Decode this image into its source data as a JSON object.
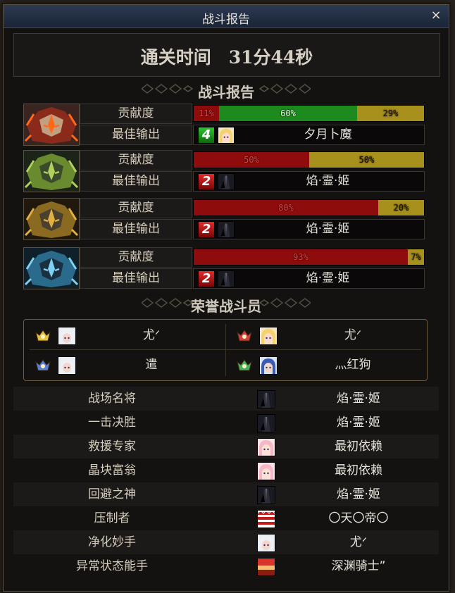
{
  "window": {
    "title": "战斗报告",
    "close_glyph": "×"
  },
  "clear_time": "通关时间　31分44秒",
  "sections": {
    "battle_report": "战斗报告",
    "honor": "荣誉战斗员"
  },
  "labels": {
    "contribution": "贡献度",
    "best_output": "最佳输出"
  },
  "colors": {
    "bar_red": "#8e0c0c",
    "bar_green": "#1c8a1c",
    "bar_gold": "#a8901c",
    "rank_green": "#1c8a1c",
    "rank_red": "#b81414"
  },
  "bosses": [
    {
      "portrait": "red-flame-demon-boss-icon",
      "contribution": [
        {
          "label": "11%",
          "value": 11,
          "color": "red"
        },
        {
          "label": "60%",
          "value": 60,
          "color": "green"
        },
        {
          "label": "29%",
          "value": 29,
          "color": "gold"
        }
      ],
      "best_output": {
        "rank": "4",
        "rank_color": "green",
        "avatar": "blonde-girl-avatar",
        "name": "夕月卜魔"
      }
    },
    {
      "portrait": "green-thorn-demon-boss-icon",
      "contribution": [
        {
          "label": "50%",
          "value": 50,
          "color": "red"
        },
        {
          "label": "50%",
          "value": 50,
          "color": "gold"
        }
      ],
      "best_output": {
        "rank": "2",
        "rank_color": "red",
        "avatar": "dark-swordsman-avatar",
        "name": "焰·霊·姬"
      }
    },
    {
      "portrait": "gold-armored-demon-boss-icon",
      "contribution": [
        {
          "label": "80%",
          "value": 80,
          "color": "red"
        },
        {
          "label": "20%",
          "value": 20,
          "color": "gold"
        }
      ],
      "best_output": {
        "rank": "2",
        "rank_color": "red",
        "avatar": "dark-swordsman-avatar",
        "name": "焰·霊·姬"
      }
    },
    {
      "portrait": "blue-ice-demon-boss-icon",
      "contribution": [
        {
          "label": "93%",
          "value": 93,
          "color": "red"
        },
        {
          "label": "7%",
          "value": 7,
          "color": "gold"
        }
      ],
      "best_output": {
        "rank": "2",
        "rank_color": "red",
        "avatar": "dark-swordsman-avatar",
        "name": "焰·霊·姬"
      }
    }
  ],
  "honor_members": [
    {
      "medal": "gold-medal-icon",
      "avatar": "white-hair-girl-avatar",
      "name": "尤ᐟ"
    },
    {
      "medal": "red-medal-icon",
      "avatar": "blonde-girl-avatar",
      "name": "尤ᐟ"
    },
    {
      "medal": "blue-medal-icon",
      "avatar": "white-hair-girl-avatar",
      "name": "遣"
    },
    {
      "medal": "green-medal-icon",
      "avatar": "blue-hair-girl-avatar",
      "name": "灬红狗"
    }
  ],
  "awards": [
    {
      "title": "战场名将",
      "avatar": "dark-swordsman-avatar",
      "name": "焰·霊·姬"
    },
    {
      "title": "一击决胜",
      "avatar": "dark-swordsman-avatar",
      "name": "焰·霊·姬"
    },
    {
      "title": "救援专家",
      "avatar": "pink-hair-girl-avatar",
      "name": "最初依赖"
    },
    {
      "title": "晶块富翁",
      "avatar": "pink-hair-girl-avatar",
      "name": "最初依赖"
    },
    {
      "title": "回避之神",
      "avatar": "dark-swordsman-avatar",
      "name": "焰·霊·姬"
    },
    {
      "title": "压制者",
      "avatar": "red-striped-avatar",
      "name": "〇天〇帝〇"
    },
    {
      "title": "净化妙手",
      "avatar": "white-hair-girl-avatar",
      "name": "尤ᐟ"
    },
    {
      "title": "异常状态能手",
      "avatar": "red-banner-avatar",
      "name": "深渊骑士”"
    }
  ]
}
